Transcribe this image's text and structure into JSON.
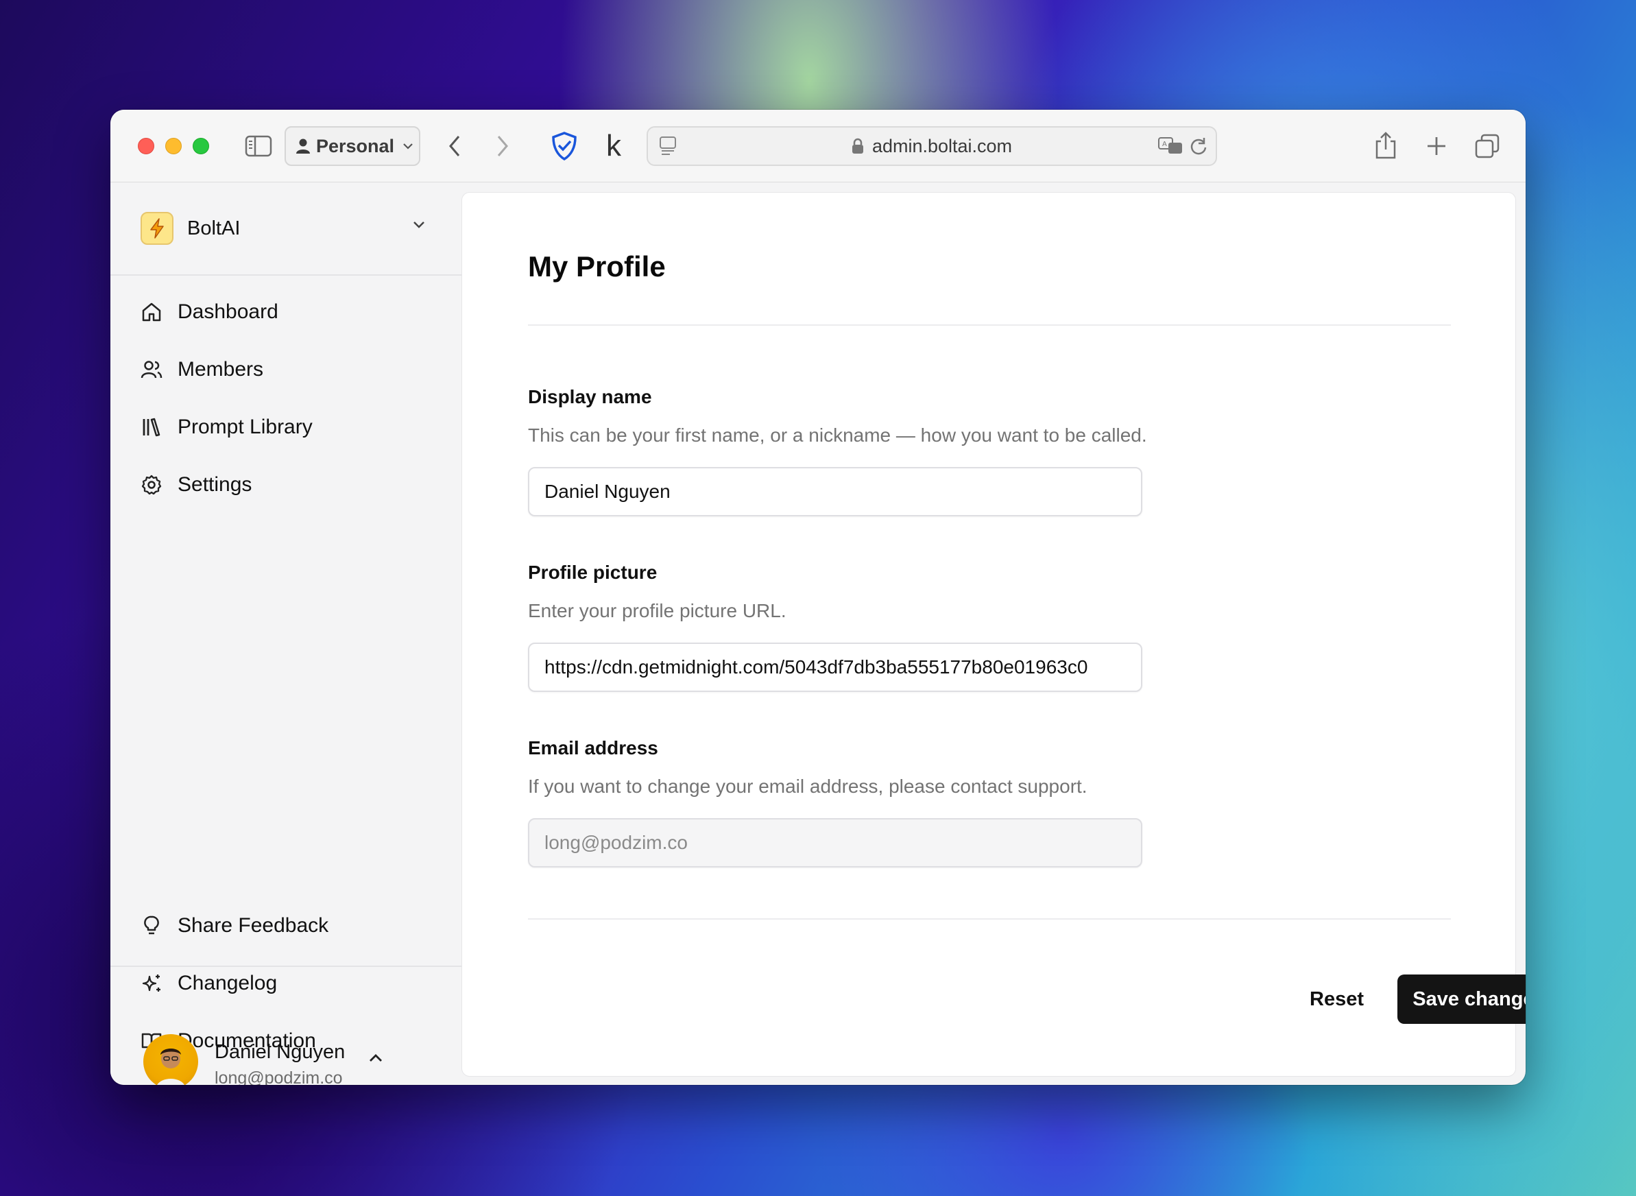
{
  "browser": {
    "profile_label": "Personal",
    "url": "admin.boltai.com"
  },
  "sidebar": {
    "workspace_name": "BoltAI",
    "nav_items": [
      {
        "label": "Dashboard",
        "icon": "home-icon"
      },
      {
        "label": "Members",
        "icon": "users-icon"
      },
      {
        "label": "Prompt Library",
        "icon": "library-icon"
      },
      {
        "label": "Settings",
        "icon": "gear-icon"
      }
    ],
    "bottom_items": [
      {
        "label": "Share Feedback",
        "icon": "lightbulb-icon"
      },
      {
        "label": "Changelog",
        "icon": "sparkles-icon"
      },
      {
        "label": "Documentation",
        "icon": "book-icon"
      }
    ],
    "user": {
      "name": "Daniel Nguyen",
      "email": "long@podzim.co"
    }
  },
  "main": {
    "title": "My Profile",
    "display_name": {
      "label": "Display name",
      "help": "This can be your first name, or a nickname — how you want to be called.",
      "value": "Daniel Nguyen"
    },
    "profile_picture": {
      "label": "Profile picture",
      "help": "Enter your profile picture URL.",
      "value": "https://cdn.getmidnight.com/5043df7db3ba555177b80e01963c0"
    },
    "email": {
      "label": "Email address",
      "help": "If you want to change your email address, please contact support.",
      "value": "long@podzim.co"
    },
    "reset_label": "Reset",
    "save_label": "Save changes"
  },
  "colors": {
    "primary_button": "#141414",
    "brand_logo_bg": "#fde68a",
    "close": "#ff5f57",
    "minimize": "#febc2e",
    "zoom": "#28c840"
  }
}
